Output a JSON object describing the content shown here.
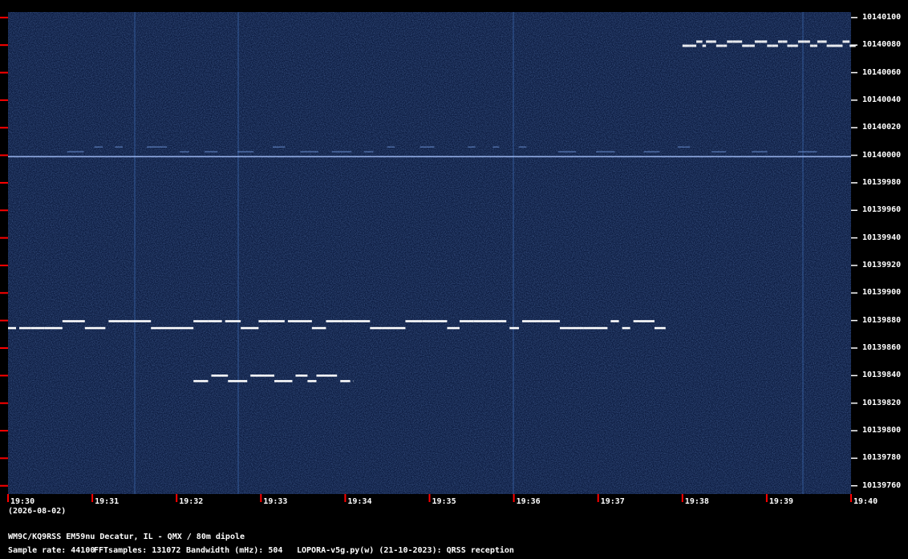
{
  "title": "WM9C/KQ9RSS EM59nu Decatur, IL - QMX / 80m dipole",
  "date": "(2026-08-02)",
  "info": {
    "sample_rate": "Sample rate: 44100",
    "fft": "FFTsamples: 131072",
    "bandwidth": "Bandwidth (mHz): 504",
    "software": "LOPORA-v5g.py(w) (21-10-2023): QRSS reception"
  },
  "colors": {
    "background": "#0b1a3e",
    "trace": "#ffffff",
    "tick": "#ff0000"
  },
  "chart_data": {
    "type": "heatmap",
    "title": "",
    "xlabel": "",
    "ylabel": "",
    "x_ticks": [
      "19:30",
      "19:31",
      "19:32",
      "19:33",
      "19:34",
      "19:35",
      "19:36",
      "19:37",
      "19:38",
      "19:39",
      "19:40"
    ],
    "y_ticks": [
      "10140100",
      "10140080",
      "10140060",
      "10140040",
      "10140020",
      "10140000",
      "10139980",
      "10139960",
      "10139940",
      "10139920",
      "10139900",
      "10139880",
      "10139860",
      "10139840",
      "10139820",
      "10139800",
      "10139780",
      "10139760"
    ],
    "x_range": [
      "19:30",
      "19:40"
    ],
    "y_range_hz": [
      10139754,
      10140104
    ],
    "grid": false,
    "signals": [
      {
        "start": "19:30.0",
        "end": "19:37.8",
        "freq_hz": 10139877,
        "shift_hz": 5,
        "type": "fsk"
      },
      {
        "start": "19:32.2",
        "end": "19:34.1",
        "freq_hz": 10139838,
        "shift_hz": 4,
        "type": "fsk"
      },
      {
        "start": "19:38.0",
        "end": "19:40.0",
        "freq_hz": 10140081,
        "shift_hz": 3,
        "type": "fsk-dense"
      },
      {
        "start": "19:30.0",
        "end": "19:40.0",
        "freq_hz": 10139999,
        "shift_hz": 0,
        "type": "carrier"
      },
      {
        "start": "19:30.7",
        "end": "19:39.8",
        "freq_hz": 10140006,
        "shift_hz": 0,
        "type": "faint-dashes"
      }
    ]
  }
}
